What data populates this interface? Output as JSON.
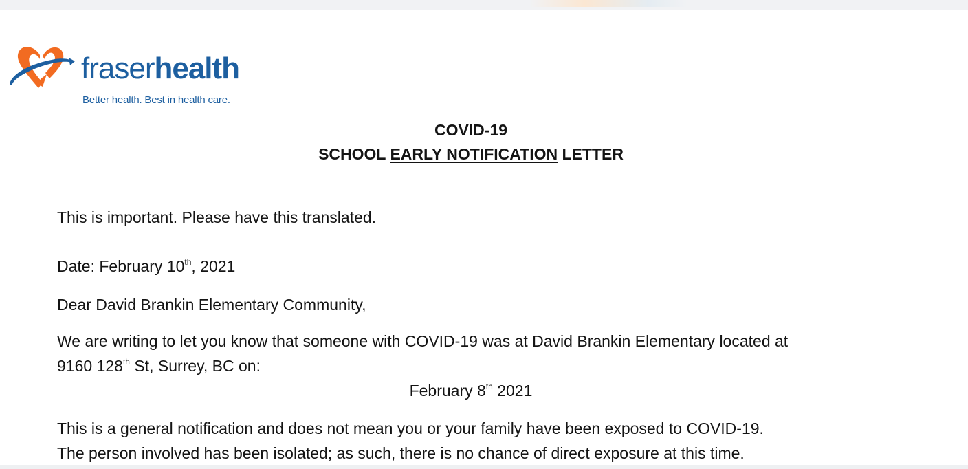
{
  "logo": {
    "word_light": "fraser",
    "word_bold": "health",
    "tagline": "Better health. Best in health care.",
    "colors": {
      "blue": "#1d5fa0",
      "orange": "#f26b21"
    }
  },
  "heading": {
    "line1": "COVID-19",
    "line2_pre": "SCHOOL ",
    "line2_underlined": "EARLY NOTIFICATION",
    "line2_post": " LETTER"
  },
  "body": {
    "important": "This is important. Please have this translated.",
    "date": {
      "pre": "Date: February 10",
      "sup": "th",
      "post": ", 2021"
    },
    "salutation": "Dear David Brankin Elementary  Community,",
    "para1_line1": "We are writing to let you know that someone with COVID-19 was at David Brankin Elementary located at",
    "para1_line2": {
      "pre": "9160 128",
      "sup": "th",
      "post": " St, Surrey, BC on:"
    },
    "exposure_date": {
      "pre": "February 8",
      "sup": "th",
      "post": " 2021"
    },
    "para2_line1": "This is a general notification and does not mean you or your family have been exposed to COVID-19.",
    "para2_line2": "The person involved has been isolated; as such, there is no chance of direct exposure at this time."
  }
}
